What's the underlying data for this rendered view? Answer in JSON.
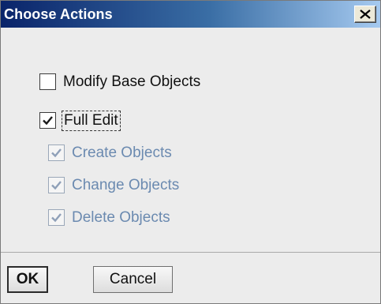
{
  "dialog": {
    "title": "Choose Actions",
    "close_icon": "close-icon"
  },
  "options": [
    {
      "label": "Modify Base Objects",
      "checked": false,
      "enabled": true
    },
    {
      "label": "Full Edit",
      "checked": true,
      "enabled": true,
      "focused": true
    },
    {
      "label": "Create Objects",
      "checked": true,
      "enabled": false
    },
    {
      "label": "Change Objects",
      "checked": true,
      "enabled": false
    },
    {
      "label": "Delete Objects",
      "checked": true,
      "enabled": false
    }
  ],
  "buttons": {
    "ok_label": "OK",
    "cancel_label": "Cancel"
  },
  "colors": {
    "title_gradient_start": "#0a246a",
    "title_gradient_end": "#a6caf0",
    "disabled_text": "#6b8ab0"
  }
}
